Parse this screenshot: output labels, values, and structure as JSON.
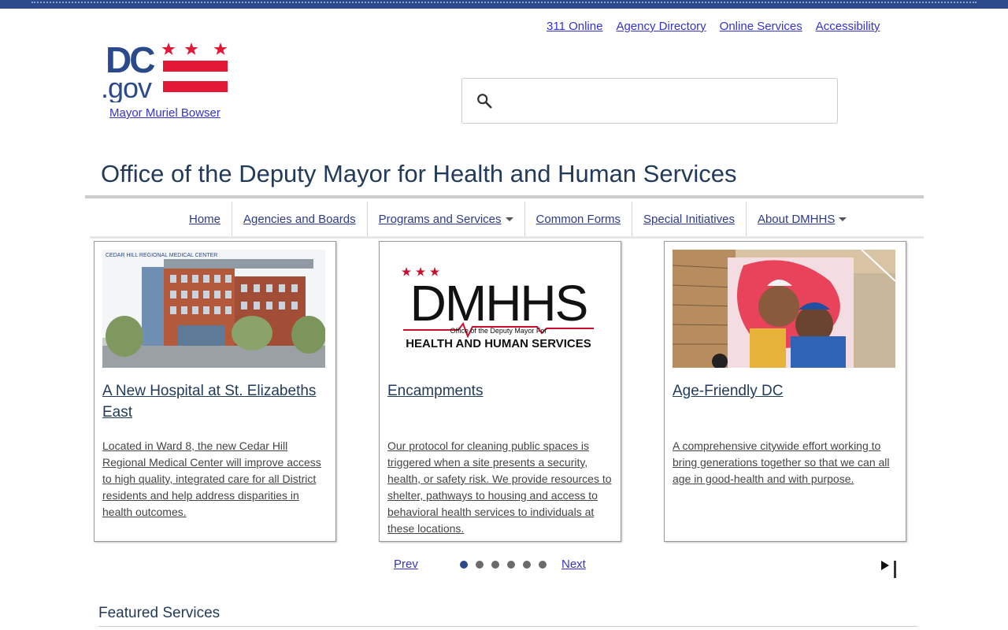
{
  "utility_links": [
    "311 Online",
    "Agency Directory",
    "Online Services",
    "Accessibility"
  ],
  "logo": {
    "text_dc": "DC",
    "text_gov": ".gov",
    "alt": "DC.gov logo"
  },
  "mayor_link": "Mayor Muriel Bowser",
  "search": {
    "placeholder": "",
    "icon": "search-icon"
  },
  "site_title": "Office of the Deputy Mayor for Health and Human Services",
  "nav": [
    {
      "label": "Home",
      "dropdown": false
    },
    {
      "label": "Agencies and Boards",
      "dropdown": false
    },
    {
      "label": "Programs and Services",
      "dropdown": true
    },
    {
      "label": "Common Forms",
      "dropdown": false
    },
    {
      "label": "Special Initiatives",
      "dropdown": false
    },
    {
      "label": "About DMHHS",
      "dropdown": true
    }
  ],
  "cards": [
    {
      "title": "A New Hospital at St. Elizabeths East",
      "description": "Located in Ward 8, the new Cedar Hill Regional Medical Center will improve access to high quality, integrated care for all District residents and help address disparities in health outcomes.",
      "image_text": "CEDAR HILL REGIONAL MEDICAL CENTER"
    },
    {
      "title": "Encampments",
      "description": "Our protocol for cleaning public spaces is triggered when a site presents a security, health, or safety risk. We provide resources to shelter, pathways to housing and access to behavioral health services to individuals at these locations.",
      "image_text": {
        "big": "DMHHS",
        "line1": "Office of the Deputy Mayor For",
        "line2": "HEALTH AND HUMAN SERVICES"
      }
    },
    {
      "title": "Age-Friendly DC",
      "description": "A comprehensive citywide effort working to bring generations together so that we can all age in good-health and with purpose.",
      "image_text": ""
    }
  ],
  "carousel": {
    "prev": "Prev",
    "next": "Next",
    "slide_count": 6,
    "active_index": 0
  },
  "featured_heading": "Featured Services",
  "colors": {
    "navy": "#2b4a8c",
    "flag_red": "#e31837",
    "title": "#233b5a"
  }
}
